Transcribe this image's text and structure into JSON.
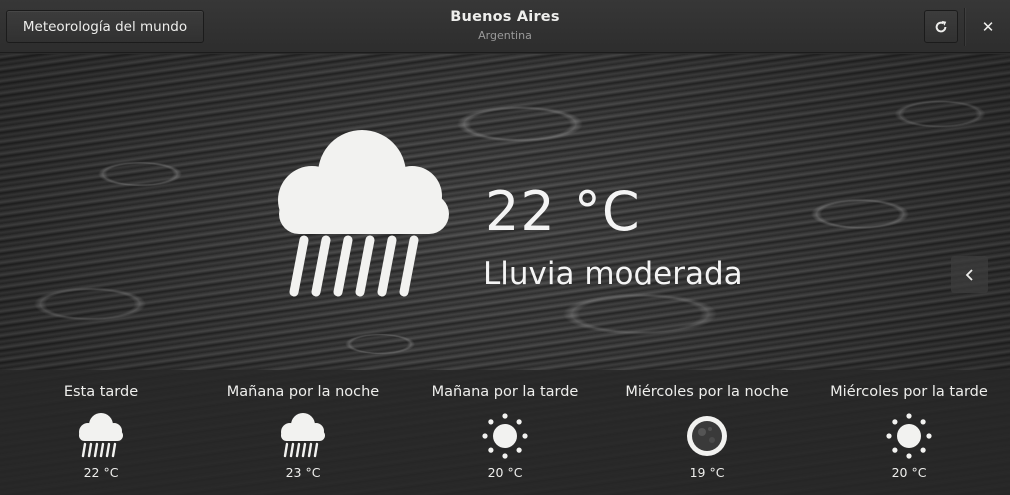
{
  "header": {
    "back_label": "Meteorología del mundo",
    "title": "Buenos Aires",
    "subtitle": "Argentina",
    "refresh_icon": "refresh-icon",
    "close_icon": "close-icon",
    "close_glyph": "✕"
  },
  "current": {
    "icon": "rain-cloud-icon",
    "temperature": "22 °C",
    "summary": "Lluvia moderada"
  },
  "nav": {
    "icon": "chevron-left-icon"
  },
  "forecast": [
    {
      "label": "Esta tarde",
      "icon": "rain-cloud-icon",
      "temp": "22 °C"
    },
    {
      "label": "Mañana por la noche",
      "icon": "rain-cloud-icon",
      "temp": "23 °C"
    },
    {
      "label": "Mañana por la tarde",
      "icon": "sun-icon",
      "temp": "20 °C"
    },
    {
      "label": "Miércoles por la noche",
      "icon": "moon-icon",
      "temp": "19 °C"
    },
    {
      "label": "Miércoles por la tarde",
      "icon": "sun-icon",
      "temp": "20 °C"
    }
  ],
  "colors": {
    "headerbar": "#2d2d2d",
    "text": "#eeeeec",
    "subtitle": "#9a9a9a",
    "forecast_strip": "#282828"
  }
}
